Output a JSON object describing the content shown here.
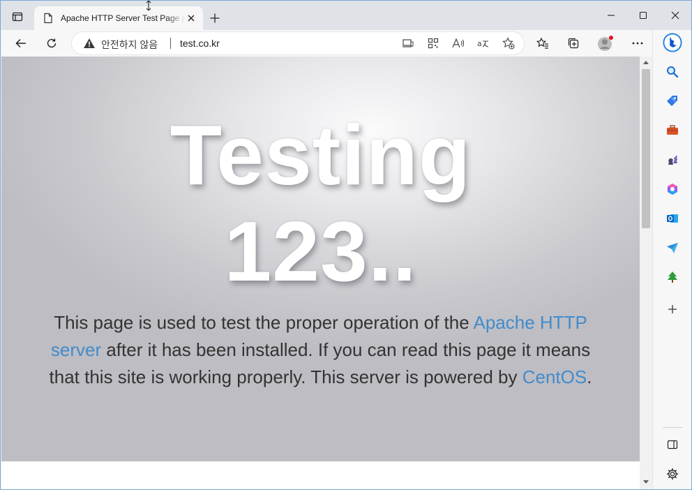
{
  "browser": {
    "tab": {
      "title": "Apache HTTP Server Test Page powered by CentOS"
    },
    "omnibox": {
      "security_label": "안전하지 않음",
      "url": "test.co.kr"
    },
    "sidebar_items": [
      "search",
      "shopping",
      "tools",
      "games",
      "microsoft-365",
      "outlook",
      "drop",
      "tree"
    ]
  },
  "page": {
    "headline_line1": "Testing",
    "headline_line2": "123..",
    "lead_part1": "This page is used to test the proper operation of the",
    "lead_link1": "Apache HTTP server",
    "lead_part2": " after it has been installed. If you can read this page it means that this site is working properly. This server is powered by ",
    "lead_link2": "CentOS",
    "lead_part3": "."
  },
  "colors": {
    "link": "#428bca",
    "text": "#333333",
    "edge_blue": "#0c59c9"
  }
}
